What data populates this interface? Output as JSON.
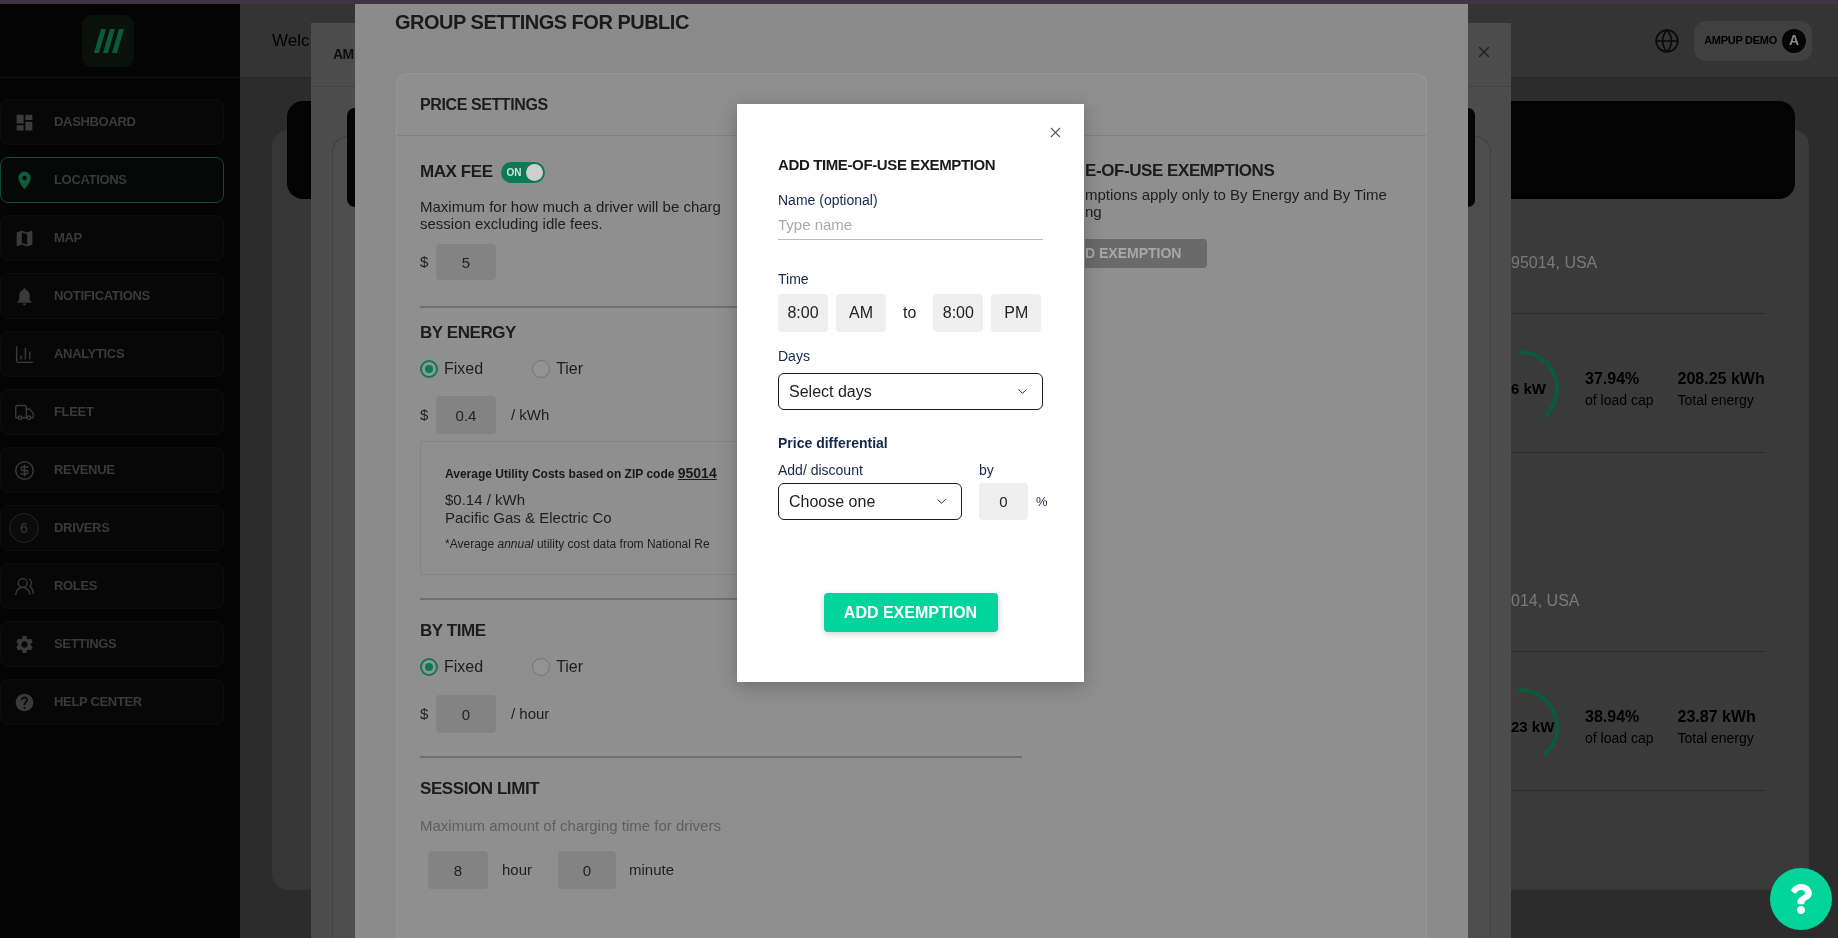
{
  "sidebar": {
    "items": [
      {
        "label": "DASHBOARD",
        "selected": false
      },
      {
        "label": "LOCATIONS",
        "selected": true
      },
      {
        "label": "MAP",
        "selected": false
      },
      {
        "label": "NOTIFICATIONS",
        "selected": false
      },
      {
        "label": "ANALYTICS",
        "selected": false
      },
      {
        "label": "FLEET",
        "selected": false
      },
      {
        "label": "REVENUE",
        "selected": false
      },
      {
        "label": "DRIVERS",
        "selected": false,
        "badge": "6"
      },
      {
        "label": "ROLES",
        "selected": false
      },
      {
        "label": "SETTINGS",
        "selected": false
      },
      {
        "label": "HELP CENTER",
        "selected": false
      }
    ]
  },
  "header": {
    "greeting": "Welc",
    "account": "AMPUP DEMO",
    "avatar": "A"
  },
  "locations": [
    {
      "address": "95014, USA",
      "power": "6 kW",
      "load": "37.94%",
      "load_label": "of load cap",
      "energy": "208.25 kWh",
      "energy_label": "Total energy"
    },
    {
      "address": "014, USA",
      "power": "23 kW",
      "load": "38.94%",
      "load_label": "of load cap",
      "energy": "23.87 kWh",
      "energy_label": "Total energy"
    }
  ],
  "back_modal": {
    "title": "AM"
  },
  "group_modal": {
    "title": "GROUP SETTINGS FOR PUBLIC",
    "card_title": "PRICE SETTINGS",
    "max_fee": {
      "label": "MAX FEE",
      "on": true,
      "toggle_text": "ON",
      "description": [
        "Maximum for how much a driver will be charg",
        "session excluding idle fees."
      ],
      "currency": "$",
      "value": "5"
    },
    "by_energy": {
      "title": "BY ENERGY",
      "options": [
        {
          "label": "Fixed",
          "selected": true
        },
        {
          "label": "Tier",
          "selected": false
        }
      ],
      "currency": "$",
      "value": "0.4",
      "unit": "/ kWh",
      "utility": {
        "heading": "Average Utility Costs based on ZIP code",
        "zip": "95014",
        "rate": "$0.14 / kWh",
        "provider": "Pacific Gas & Electric Co",
        "note_lead": "*Average",
        "note_emphasis": "annual",
        "note_rest": "utility cost data from National Re"
      }
    },
    "by_time": {
      "title": "BY TIME",
      "options": [
        {
          "label": "Fixed",
          "selected": true
        },
        {
          "label": "Tier",
          "selected": false
        }
      ],
      "currency": "$",
      "value": "0",
      "unit": "/ hour"
    },
    "session_limit": {
      "title": "SESSION LIMIT",
      "description": "Maximum amount of charging time for drivers",
      "hours": "8",
      "hours_unit": "hour",
      "minutes": "0",
      "minutes_unit": "minute"
    },
    "exemptions": {
      "title": "E-OF-USE EXEMPTIONS",
      "description": [
        "mptions apply only to By Energy and By Time",
        "ng"
      ],
      "button": "D EXEMPTION"
    }
  },
  "dialog": {
    "title": "ADD TIME-OF-USE EXEMPTION",
    "name_label": "Name (optional)",
    "name_placeholder": "Type name",
    "time_label": "Time",
    "start": "8:00",
    "start_period": "AM",
    "separator": "to",
    "end": "8:00",
    "end_period": "PM",
    "days_label": "Days",
    "days_value": "Select days",
    "price_label": "Price differential",
    "mode_label": "Add/ discount",
    "mode_value": "Choose one",
    "by_label": "by",
    "percent_value": "0",
    "percent_unit": "%",
    "submit": "ADD EXEMPTION"
  }
}
